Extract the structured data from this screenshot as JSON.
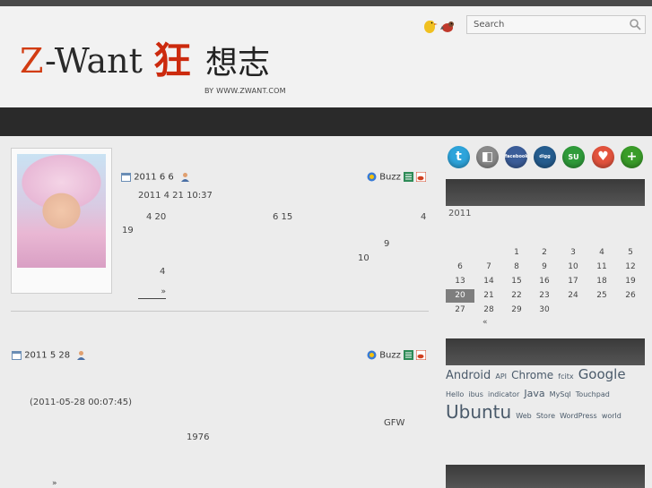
{
  "search": {
    "placeholder": "Search"
  },
  "logo": {
    "z": "Z",
    "want": "-Want",
    "kuang": "狂",
    "rest": "想志",
    "byline": "BY WWW.ZWANT.COM"
  },
  "post1": {
    "date": "2011 6 6",
    "buzz": "Buzz",
    "lines": [
      "2011 4 21  10:37",
      "4 20",
      "6 15",
      "4",
      "19",
      "9",
      "10",
      "4"
    ],
    "more": "»"
  },
  "post2": {
    "date": "2011 5 28",
    "buzz": "Buzz",
    "lines": [
      "(2011-05-28 00:07:45)",
      "GFW",
      "1976"
    ],
    "more": "»"
  },
  "social": [
    {
      "name": "twitter",
      "color": "#2ea4db",
      "glyph": "t"
    },
    {
      "name": "delicious",
      "color": "#8a8a8a",
      "glyph": "◧"
    },
    {
      "name": "facebook",
      "color": "#3b5d99",
      "glyph": "facebook"
    },
    {
      "name": "digg",
      "color": "#255d8f",
      "glyph": "digg"
    },
    {
      "name": "stumbleupon",
      "color": "#2f9b3a",
      "glyph": "SU"
    },
    {
      "name": "favorite",
      "color": "#e3533d",
      "glyph": "♥"
    },
    {
      "name": "add",
      "color": "#3a9c29",
      "glyph": "+"
    }
  ],
  "calendar": {
    "year": "2011",
    "rows": [
      [
        "",
        "",
        "1",
        "2",
        "3",
        "4",
        "5"
      ],
      [
        "6",
        "7",
        "8",
        "9",
        "10",
        "11",
        "12"
      ],
      [
        "13",
        "14",
        "15",
        "16",
        "17",
        "18",
        "19"
      ],
      [
        "20",
        "21",
        "22",
        "23",
        "24",
        "25",
        "26"
      ],
      [
        "27",
        "28",
        "29",
        "30",
        "",
        "",
        ""
      ]
    ],
    "today": "20",
    "prev": "«"
  },
  "tags": [
    {
      "t": "Android",
      "s": 13
    },
    {
      "t": "API",
      "s": 8
    },
    {
      "t": "Chrome",
      "s": 12
    },
    {
      "t": "fcitx",
      "s": 8
    },
    {
      "t": "Google",
      "s": 15
    },
    {
      "t": "Hello",
      "s": 8
    },
    {
      "t": "ibus",
      "s": 8
    },
    {
      "t": "indicator",
      "s": 8
    },
    {
      "t": "Java",
      "s": 11
    },
    {
      "t": "MySql",
      "s": 8
    },
    {
      "t": "Touchpad",
      "s": 8
    },
    {
      "t": "Ubuntu",
      "s": 20
    },
    {
      "t": "Web",
      "s": 8
    },
    {
      "t": "Store",
      "s": 8
    },
    {
      "t": "WordPress",
      "s": 8
    },
    {
      "t": "world",
      "s": 8
    }
  ],
  "colors": {
    "navbar": "#2a2a2a",
    "accent": "#d23c12",
    "today": "#7e7e7e"
  }
}
